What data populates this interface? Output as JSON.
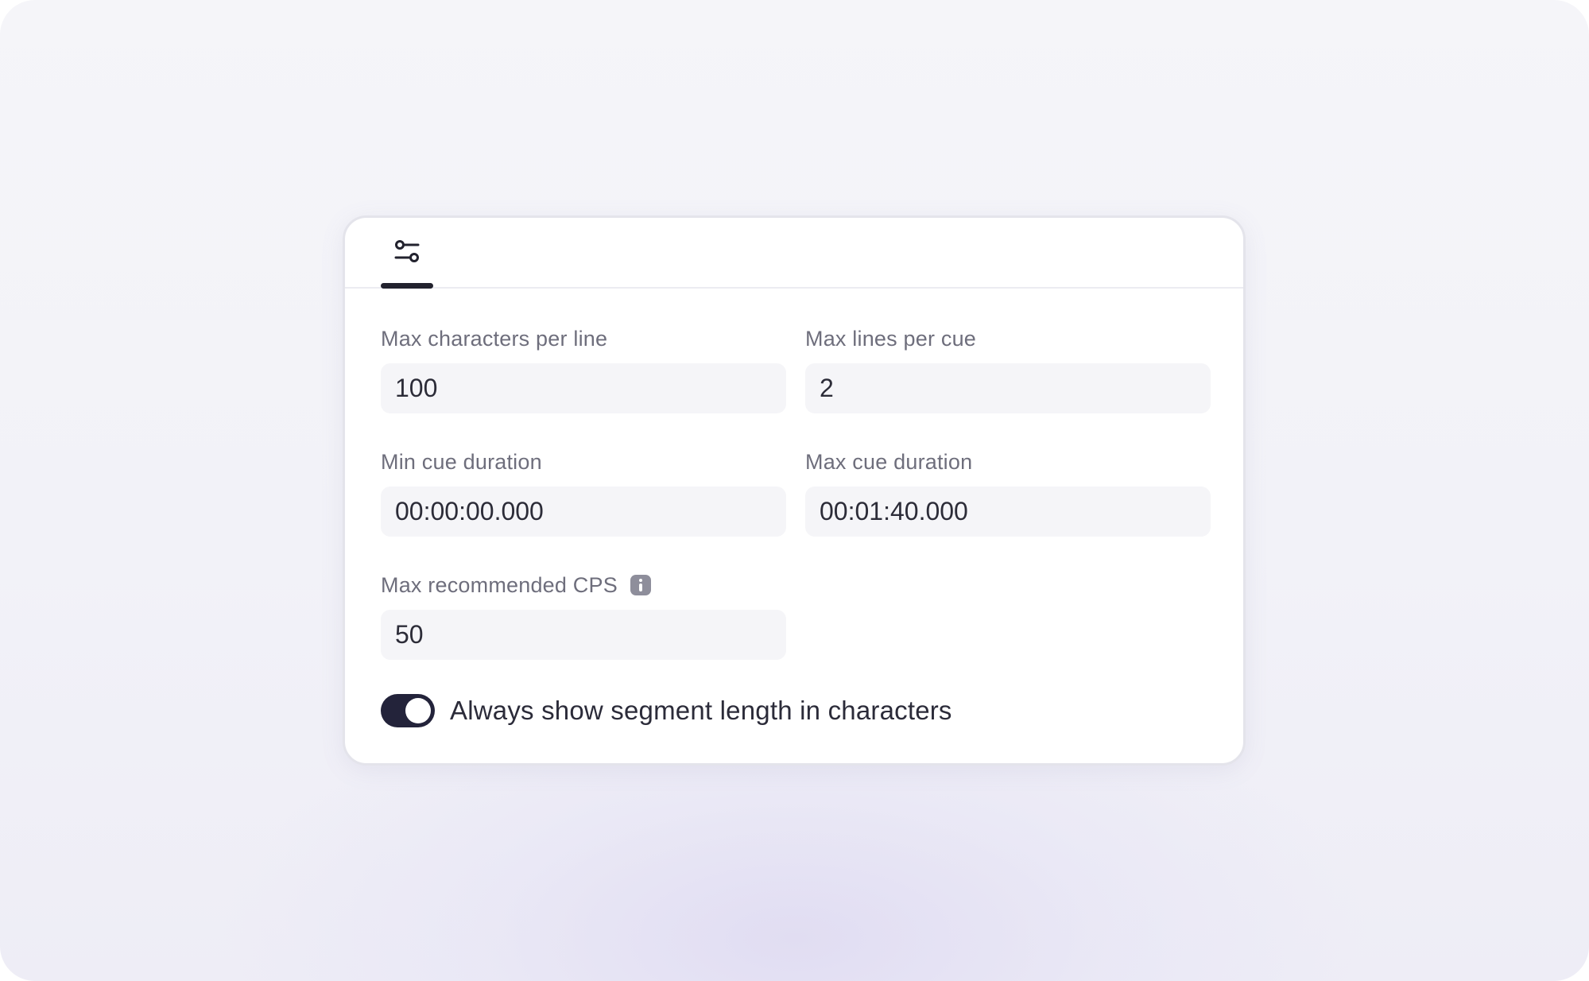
{
  "tabs": [
    {
      "icon": "sliders-icon",
      "active": true
    }
  ],
  "fields": {
    "max_chars_per_line": {
      "label": "Max characters per line",
      "value": "100"
    },
    "max_lines_per_cue": {
      "label": "Max lines per cue",
      "value": "2"
    },
    "min_cue_duration": {
      "label": "Min cue duration",
      "value": "00:00:00.000"
    },
    "max_cue_duration": {
      "label": "Max cue duration",
      "value": "00:01:40.000"
    },
    "max_recommended_cps": {
      "label": "Max recommended CPS",
      "value": "50",
      "info_icon": "info-icon"
    }
  },
  "toggle": {
    "label": "Always show segment length in characters",
    "checked": true
  },
  "colors": {
    "accent": "#23233a",
    "input_background": "#f5f5f8",
    "label_text": "#6e6e7c"
  }
}
